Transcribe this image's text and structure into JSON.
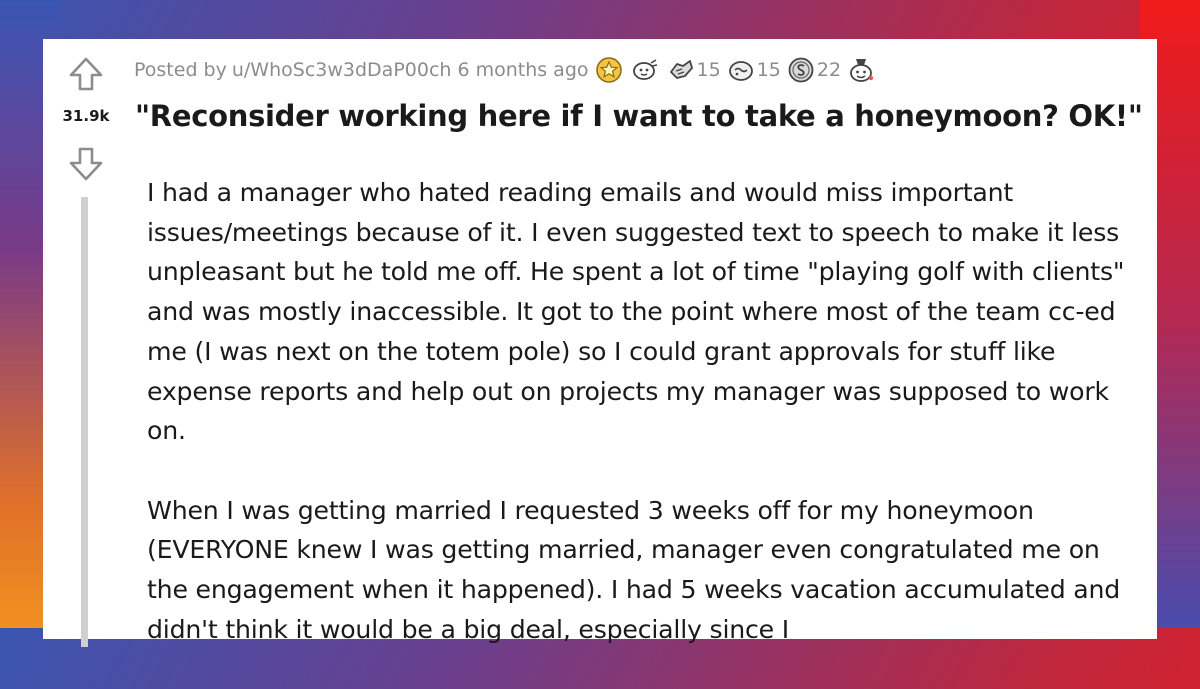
{
  "post": {
    "score": "31.9k",
    "meta": {
      "prefix": "Posted by",
      "author": "u/WhoSc3w3dDaP00ch",
      "age": "6 months ago"
    },
    "awards": [
      {
        "icon": "gold-award-icon",
        "count": ""
      },
      {
        "icon": "wholesome-award-icon",
        "count": ""
      },
      {
        "icon": "helpful-award-icon",
        "count": "15"
      },
      {
        "icon": "silver-award-icon",
        "count": "15"
      },
      {
        "icon": "coin-award-icon",
        "count": "22"
      },
      {
        "icon": "party-award-icon",
        "count": ""
      }
    ],
    "title": "\"Reconsider working here if I want to take a honeymoon? OK!\"",
    "paragraphs": [
      "I had a manager who hated reading emails and would miss important issues/meetings because of it. I even suggested text to speech to make it less unpleasant but he told me off. He spent a lot of time \"playing golf with clients\" and was mostly inaccessible. It got to the point where most of the team cc-ed me (I was next on the totem pole) so I could grant approvals for stuff like expense reports and help out on projects my manager was supposed to work on.",
      "When I was getting married I requested 3 weeks off for my honeymoon (EVERYONE knew I was getting married, manager even congratulated me on the engagement when it happened). I had 5 weeks vacation accumulated and didn't think it would be a big deal, especially since I"
    ]
  },
  "colors": {
    "text": "#1a1a1b",
    "meta_text": "#8a8c8e",
    "thread_line": "#cfcfcf",
    "card": "#ffffff"
  }
}
